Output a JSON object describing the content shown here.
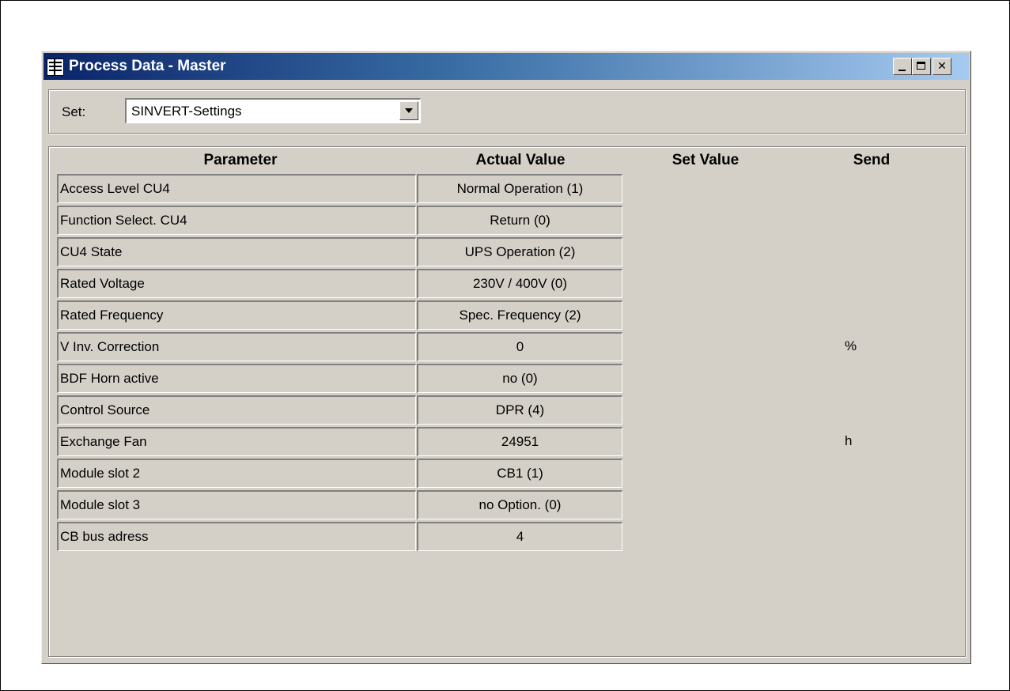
{
  "window": {
    "title": "Process Data - Master",
    "icon": "table-icon",
    "controls": {
      "minimize_icon": "minimize-icon",
      "maximize_icon": "maximize-icon",
      "close_label": "✕"
    }
  },
  "set_selector": {
    "label": "Set:",
    "value": "SINVERT-Settings"
  },
  "table": {
    "headers": {
      "parameter": "Parameter",
      "actual_value": "Actual Value",
      "set_value": "Set Value",
      "send": "Send"
    },
    "rows": [
      {
        "parameter": "Access Level CU4",
        "actual": "Normal Operation (1)",
        "unit": ""
      },
      {
        "parameter": "Function Select. CU4",
        "actual": "Return (0)",
        "unit": ""
      },
      {
        "parameter": "CU4 State",
        "actual": "UPS Operation (2)",
        "unit": ""
      },
      {
        "parameter": "Rated Voltage",
        "actual": "230V / 400V (0)",
        "unit": ""
      },
      {
        "parameter": "Rated Frequency",
        "actual": "Spec. Frequency (2)",
        "unit": ""
      },
      {
        "parameter": "V Inv. Correction",
        "actual": "0",
        "unit": "%"
      },
      {
        "parameter": "BDF Horn active",
        "actual": "no (0)",
        "unit": ""
      },
      {
        "parameter": "Control Source",
        "actual": "DPR (4)",
        "unit": ""
      },
      {
        "parameter": "Exchange Fan",
        "actual": "24951",
        "unit": "h"
      },
      {
        "parameter": "Module slot 2",
        "actual": "CB1 (1)",
        "unit": ""
      },
      {
        "parameter": "Module slot 3",
        "actual": "no Option. (0)",
        "unit": ""
      },
      {
        "parameter": "CB bus adress",
        "actual": "4",
        "unit": ""
      }
    ]
  },
  "colors": {
    "titlebar_start": "#0a246a",
    "titlebar_end": "#a6caf0",
    "face": "#d4d0c8"
  }
}
